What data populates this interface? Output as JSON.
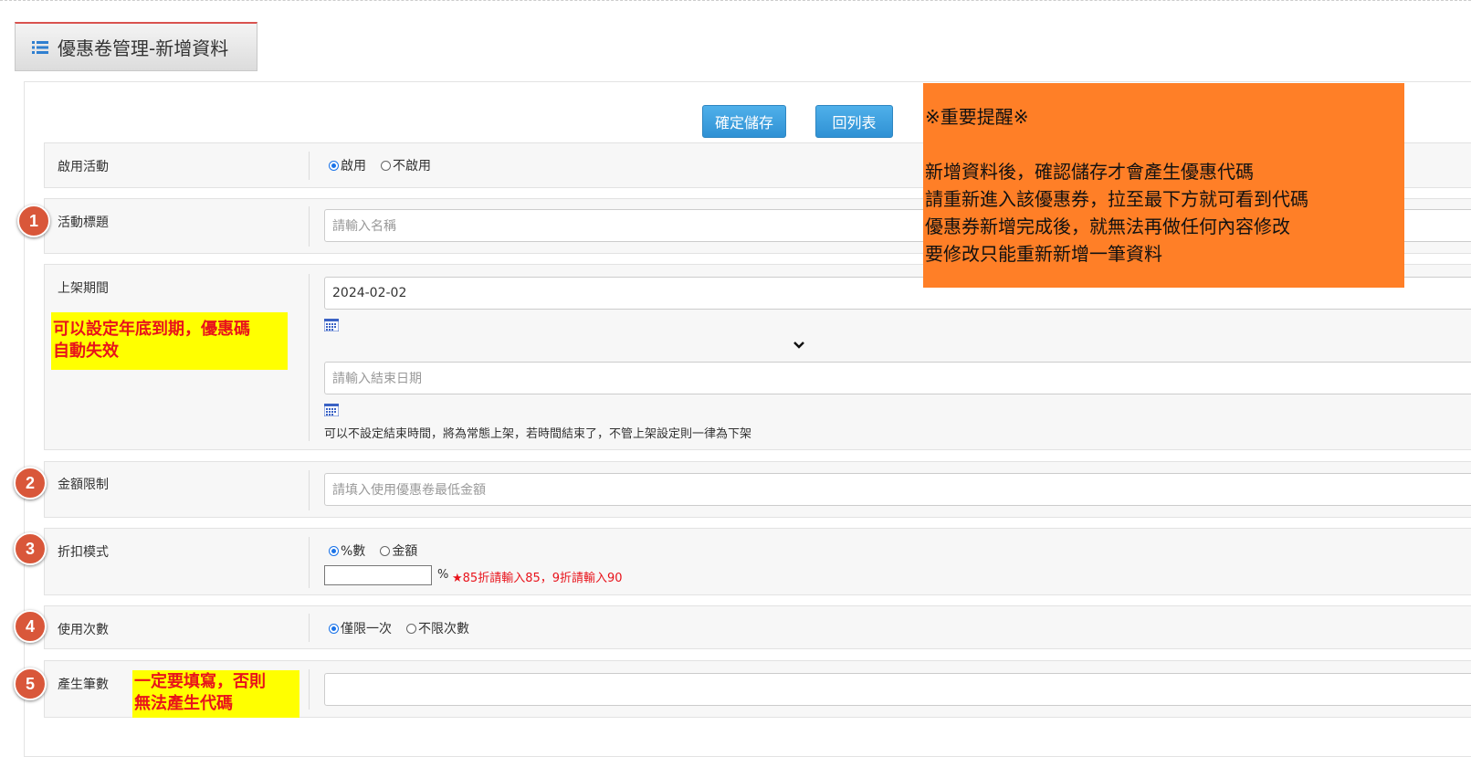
{
  "header": {
    "title": "優惠卷管理-新增資料"
  },
  "toolbar": {
    "save_label": "確定儲存",
    "back_label": "回列表"
  },
  "notice": {
    "heading": "※重要提醒※",
    "lines": [
      "新增資料後，確認儲存才會產生優惠代碼",
      "請重新進入該優惠券，拉至最下方就可看到代碼",
      "優惠券新增完成後，就無法再做任何內容修改",
      "要修改只能重新新增一筆資料"
    ],
    "color": "#ff7f27"
  },
  "form": {
    "activate": {
      "label": "啟用活動",
      "options": [
        "啟用",
        "不啟用"
      ],
      "selected": "啟用"
    },
    "title": {
      "label": "活動標題",
      "placeholder": "請輸入名稱",
      "badge": "1"
    },
    "period": {
      "label": "上架期間",
      "start_value": "2024-02-02",
      "end_placeholder": "請輸入結束日期",
      "hint": "可以不設定結束時間，將為常態上架，若時間結束了，不管上架設定則一律為下架",
      "note_line1": "可以設定年底到期，優惠碼",
      "note_line2": "自動失效"
    },
    "amount": {
      "label": "金額限制",
      "placeholder": "請填入使用優惠卷最低金額",
      "badge": "2"
    },
    "discount": {
      "label": "折扣模式",
      "badge": "3",
      "options": [
        "%數",
        "金額"
      ],
      "selected": "%數",
      "unit": "%",
      "hint": "★85折請輸入85，9折請輸入90"
    },
    "usage": {
      "label": "使用次數",
      "badge": "4",
      "options": [
        "僅限一次",
        "不限次數"
      ],
      "selected": "僅限一次"
    },
    "count": {
      "label": "產生筆數",
      "badge": "5",
      "note_line1": "一定要填寫，否則",
      "note_line2": "無法產生代碼"
    }
  },
  "colors": {
    "accent": "#2f91d4",
    "badge": "#d9573a",
    "warning_text": "#e8131b",
    "highlight": "#ffff00"
  }
}
